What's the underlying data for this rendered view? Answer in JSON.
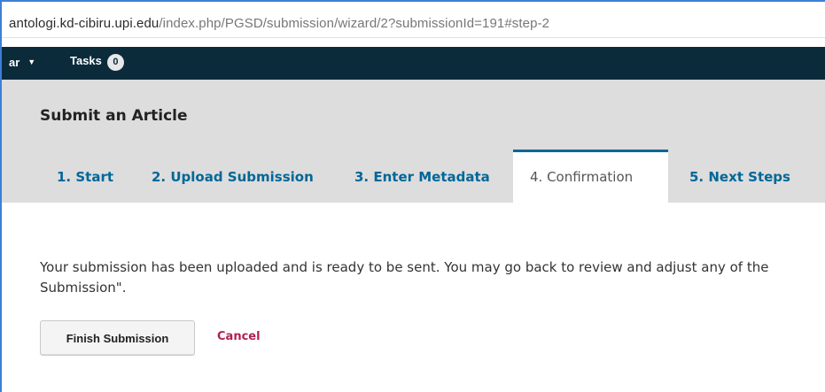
{
  "browser": {
    "url_domain": "antologi.kd-cibiru.upi.edu",
    "url_path": "/index.php/PGSD/submission/wizard/2?submissionId=191#step-2"
  },
  "nav": {
    "user_menu_label": "ar",
    "tasks_label": "Tasks",
    "tasks_count": "0"
  },
  "page": {
    "title": "Submit an Article"
  },
  "tabs": [
    {
      "label": "1. Start"
    },
    {
      "label": "2. Upload Submission"
    },
    {
      "label": "3. Enter Metadata"
    },
    {
      "label": "4. Confirmation",
      "active": true
    },
    {
      "label": "5. Next Steps"
    }
  ],
  "content": {
    "line1": "Your submission has been uploaded and is ready to be sent. You may go back to review and adjust any of the",
    "line2": "Submission\"."
  },
  "actions": {
    "finish_label": "Finish Submission",
    "cancel_label": "Cancel"
  },
  "colors": {
    "nav_bg": "#0b2b3b",
    "tab_link": "#006798",
    "cancel_link": "#b2204e",
    "header_band": "#dddddd"
  }
}
